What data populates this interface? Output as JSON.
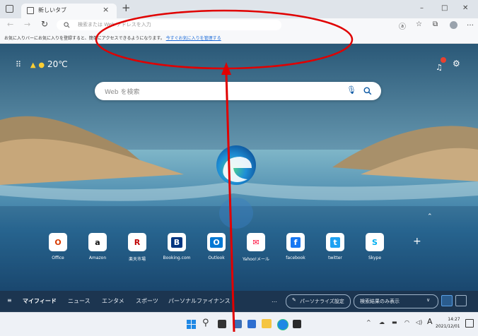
{
  "browser": {
    "tab_title": "新しいタブ",
    "address_placeholder": "検索または Web アドレスを入力",
    "favorites_bar_text": "お気に入りバーにお気に入りを登録すると、簡単にアクセスできるようになります。",
    "favorites_bar_link": "今すぐお気に入りを管理する"
  },
  "newtab": {
    "weather_temp": "20℃",
    "search_placeholder": "Web を検索",
    "quick_links": [
      {
        "label": "Office",
        "icon": "office-icon",
        "color": "#d83b01",
        "glyph": "O"
      },
      {
        "label": "Amazon",
        "icon": "amazon-icon",
        "color": "#111111",
        "glyph": "a"
      },
      {
        "label": "楽天市場",
        "icon": "rakuten-icon",
        "color": "#bf0000",
        "glyph": "R"
      },
      {
        "label": "Booking.com",
        "icon": "booking-icon",
        "color": "#003580",
        "glyph": "B"
      },
      {
        "label": "Outlook",
        "icon": "outlook-icon",
        "color": "#0078d4",
        "glyph": "O"
      },
      {
        "label": "Yahoo!メール",
        "icon": "yahoo-mail-icon",
        "color": "#ff0033",
        "glyph": "✉"
      },
      {
        "label": "facebook",
        "icon": "facebook-icon",
        "color": "#1877f2",
        "glyph": "f"
      },
      {
        "label": "twitter",
        "icon": "twitter-icon",
        "color": "#1da1f2",
        "glyph": "t"
      },
      {
        "label": "Skype",
        "icon": "skype-icon",
        "color": "#00aff0",
        "glyph": "S"
      }
    ],
    "nav": {
      "my_feed": "マイフィード",
      "news": "ニュース",
      "entertainment": "エンタメ",
      "sports": "スポーツ",
      "finance": "パーソナルファイナンス",
      "more": "…",
      "personalize": "パーソナライズ設定",
      "view_option": "検索結果のみ表示"
    }
  },
  "taskbar": {
    "time": "14:27",
    "date": "2021/12/01",
    "ime": "A"
  },
  "colors": {
    "annotation": "#e00000",
    "edge_blue": "#0c59a4",
    "edge_green": "#33c481"
  }
}
